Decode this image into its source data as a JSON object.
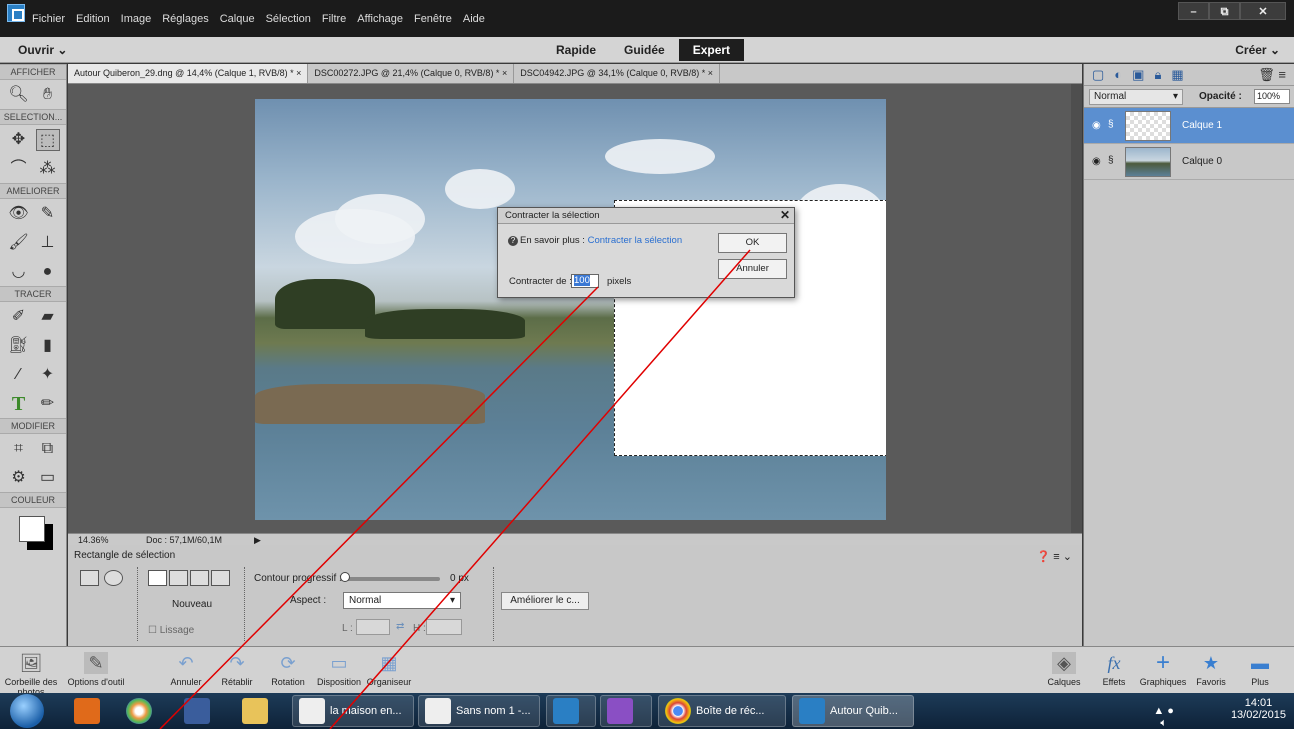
{
  "menubar": {
    "items": [
      "Fichier",
      "Edition",
      "Image",
      "Réglages",
      "Calque",
      "Sélection",
      "Filtre",
      "Affichage",
      "Fenêtre",
      "Aide"
    ],
    "window_buttons": [
      "–",
      "⧉",
      "✕"
    ]
  },
  "modebar": {
    "open_label": "Ouvrir  ⌄",
    "modes": [
      "Rapide",
      "Guidée",
      "Expert"
    ],
    "active_mode": "Expert",
    "create_label": "Créer  ⌄"
  },
  "toolbox": {
    "sections": [
      "AFFICHER",
      "SELECTION...",
      "AMELIORER",
      "TRACER",
      "MODIFIER",
      "COULEUR"
    ]
  },
  "doc_tabs": [
    "Autour Quiberon_29.dng @ 14,4% (Calque 1, RVB/8) *  ×",
    "DSC00272.JPG @ 21,4% (Calque 0, RVB/8) *  ×",
    "DSC04942.JPG @ 34,1% (Calque 0, RVB/8) *  ×"
  ],
  "canvas_status": {
    "zoom": "14.36%",
    "doc": "Doc : 57,1M/60,1M"
  },
  "options": {
    "title": "Rectangle de sélection",
    "nouveau": "Nouveau",
    "lissage": "Lissage",
    "contour_label": "Contour progressif :",
    "contour_value": "0 px",
    "aspect_label": "Aspect :",
    "aspect_value": "Normal",
    "l_label": "L :",
    "h_label": "H :",
    "ameliorer": "Améliorer le c..."
  },
  "layers_panel": {
    "blend_mode": "Normal",
    "opacity_label": "Opacité :",
    "opacity_value": "100%",
    "layers": [
      {
        "name": "Calque 1",
        "active": true
      },
      {
        "name": "Calque 0",
        "active": false
      }
    ]
  },
  "dialog": {
    "title": "Contracter la sélection",
    "info_prefix": "En savoir plus :",
    "info_link": "Contracter la sélection",
    "ok": "OK",
    "cancel": "Annuler",
    "contract_label": "Contracter de :",
    "contract_value": "100",
    "unit": "pixels"
  },
  "bottombar": {
    "left_items": [
      "Corbeille des photos",
      "Options d'outil",
      "Annuler",
      "Rétablir",
      "Rotation",
      "Disposition",
      "Organiseur"
    ],
    "right_items": [
      "Calques",
      "Effets",
      "Graphiques",
      "Favoris",
      "Plus"
    ]
  },
  "taskbar": {
    "items": [
      "la maison en...",
      "Sans nom 1 -...",
      "Boîte de réc...",
      "Autour Quib..."
    ],
    "time": "14:01",
    "date": "13/02/2015"
  }
}
